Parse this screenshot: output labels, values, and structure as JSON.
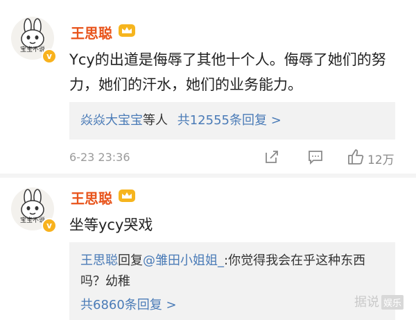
{
  "comments": [
    {
      "avatar_caption": "宝宝不说",
      "username": "王思聪",
      "content": "Ycy的出道是侮辱了其他十个人。侮辱了她们的努力，她们的汗水，她们的业务能力。",
      "reply_summary": {
        "names": "焱焱大宝宝",
        "etc": "等人",
        "count_text": "共12555条回复 >"
      },
      "timestamp": "6-23 23:36",
      "likes": "12万"
    },
    {
      "avatar_caption": "宝宝不说",
      "username": "王思聪",
      "content": "坐等ycy哭戏",
      "reply": {
        "author": "王思聪",
        "verb": "回复",
        "mention": "@雏田小姐姐_",
        "text": ":你觉得我会在乎这种东西吗？幼稚",
        "count_text": "共6860条回复 >"
      }
    }
  ],
  "watermark": {
    "text": "据说",
    "tag": "娱乐"
  },
  "colors": {
    "username": "#e8531a",
    "link": "#4a7bb7",
    "reply_bg": "#f2f2f2",
    "badge": "#f8b21d"
  },
  "icons": [
    "rabbit-avatar",
    "verified-badge-icon",
    "crown-icon",
    "share-icon",
    "comment-icon",
    "like-icon"
  ]
}
